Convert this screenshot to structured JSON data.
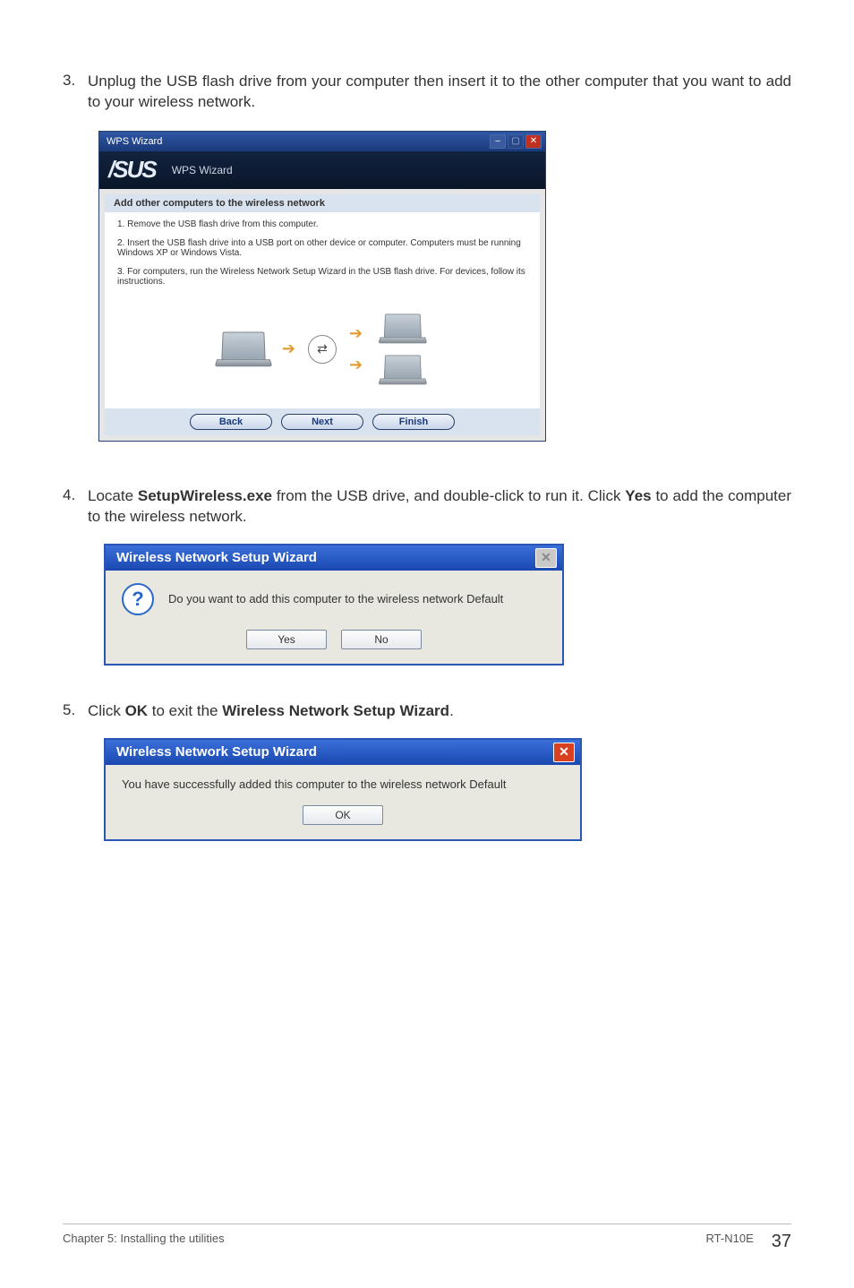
{
  "steps": {
    "s3": {
      "num": "3.",
      "text_a": "Unplug the USB flash drive from your computer then insert it to the other computer that you want to add to your wireless network."
    },
    "s4": {
      "num": "4.",
      "text_a": "Locate ",
      "bold_a": "SetupWireless.exe",
      "text_b": " from the USB drive, and double-click to run it. Click ",
      "bold_b": "Yes",
      "text_c": " to add the computer to the wireless network."
    },
    "s5": {
      "num": "5.",
      "text_a": "Click ",
      "bold_a": "OK",
      "text_b": " to exit the ",
      "bold_b": "Wireless Network Setup Wizard",
      "text_c": "."
    }
  },
  "wps": {
    "window_title": "WPS Wizard",
    "header_logo": "/SUS",
    "header_label": "WPS Wizard",
    "panel_title": "Add other computers to the wireless network",
    "line1": "1. Remove the USB flash drive from this computer.",
    "line2": "2. Insert the USB flash drive into a USB port on other device or computer. Computers must be running Windows XP or Windows Vista.",
    "line3": "3. For computers, run the Wireless Network Setup Wizard in the USB flash drive. For devices, follow its instructions.",
    "btn_back": "Back",
    "btn_next": "Next",
    "btn_finish": "Finish"
  },
  "dlg1": {
    "title": "Wireless Network Setup Wizard",
    "msg": "Do you want to add this computer to the wireless network Default",
    "btn_yes": "Yes",
    "btn_no": "No"
  },
  "dlg2": {
    "title": "Wireless Network Setup Wizard",
    "msg": "You have successfully added this computer to the wireless network Default",
    "btn_ok": "OK"
  },
  "footer": {
    "left": "Chapter 5: Installing the utilities",
    "right": "RT-N10E",
    "page": "37"
  }
}
